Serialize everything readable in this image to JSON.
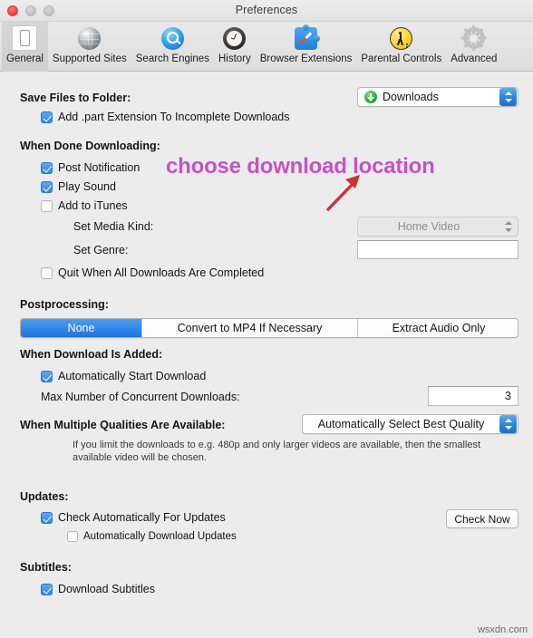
{
  "window": {
    "title": "Preferences",
    "controls": [
      "close",
      "minimize",
      "zoom"
    ]
  },
  "toolbar": {
    "items": [
      {
        "label": "General",
        "icon": "general-switch-icon",
        "selected": true
      },
      {
        "label": "Supported Sites",
        "icon": "globe-icon",
        "selected": false
      },
      {
        "label": "Search Engines",
        "icon": "magnifier-icon",
        "selected": false
      },
      {
        "label": "History",
        "icon": "clock-icon",
        "selected": false
      },
      {
        "label": "Browser Extensions",
        "icon": "puzzle-compass-icon",
        "selected": false
      },
      {
        "label": "Parental Controls",
        "icon": "parental-figure-icon",
        "selected": false
      },
      {
        "label": "Advanced",
        "icon": "gear-icon",
        "selected": false
      }
    ]
  },
  "sections": {
    "save_files": {
      "heading": "Save Files to Folder:",
      "folder_value": "Downloads",
      "folder_icon": "downloads-folder-icon",
      "add_part_extension": {
        "label": "Add .part Extension To Incomplete Downloads",
        "checked": true
      }
    },
    "when_done": {
      "heading": "When Done Downloading:",
      "post_notification": {
        "label": "Post Notification",
        "checked": true
      },
      "play_sound": {
        "label": "Play Sound",
        "checked": true
      },
      "add_to_itunes": {
        "label": "Add to iTunes",
        "checked": false
      },
      "set_media_kind": {
        "label": "Set Media Kind:",
        "value": "Home Video",
        "disabled": true
      },
      "set_genre": {
        "label": "Set Genre:",
        "value": "",
        "placeholder": ""
      },
      "quit_when_complete": {
        "label": "Quit When All Downloads Are Completed",
        "checked": false
      }
    },
    "postprocessing": {
      "heading": "Postprocessing:",
      "options": [
        "None",
        "Convert to MP4 If Necessary",
        "Extract Audio Only"
      ],
      "selected": "None"
    },
    "when_added": {
      "heading": "When Download Is Added:",
      "auto_start": {
        "label": "Automatically Start Download",
        "checked": true
      },
      "max_concurrent": {
        "label": "Max Number of Concurrent Downloads:",
        "value": "3"
      }
    },
    "qualities": {
      "heading": "When Multiple Qualities Are Available:",
      "value": "Automatically Select Best Quality",
      "help": "If you limit the downloads to e.g. 480p and only larger videos are available, then the smallest available video will be chosen."
    },
    "updates": {
      "heading": "Updates:",
      "check_automatically": {
        "label": "Check Automatically For Updates",
        "checked": true
      },
      "auto_download": {
        "label": "Automatically Download Updates",
        "checked": false
      },
      "check_now_button": "Check Now"
    },
    "subtitles": {
      "heading": "Subtitles:",
      "download_subtitles": {
        "label": "Download Subtitles",
        "checked": true
      }
    }
  },
  "annotation": {
    "text": "choose download location",
    "color": "#c453c4",
    "arrow_color": "#d22f2f"
  },
  "watermark": "wsxdn.com"
}
